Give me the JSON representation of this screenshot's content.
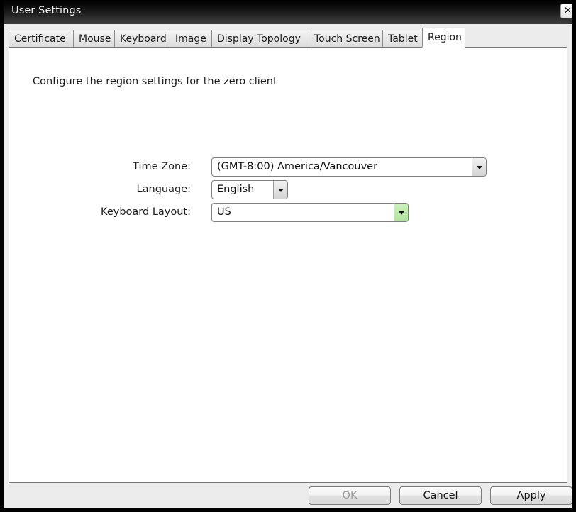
{
  "window": {
    "title": "User Settings",
    "close_icon": "close-icon",
    "close_glyph": "✕"
  },
  "tabs": [
    {
      "label": "Certificate",
      "selected": false
    },
    {
      "label": "Mouse",
      "selected": false
    },
    {
      "label": "Keyboard",
      "selected": false
    },
    {
      "label": "Image",
      "selected": false
    },
    {
      "label": "Display Topology",
      "selected": false
    },
    {
      "label": "Touch Screen",
      "selected": false
    },
    {
      "label": "Tablet",
      "selected": false
    },
    {
      "label": "Region",
      "selected": true
    }
  ],
  "panel": {
    "description": "Configure the region settings for the zero client",
    "fields": [
      {
        "label": "Time Zone:",
        "value": "(GMT-8:00) America/Vancouver",
        "arrow_icon": "chevron-down-icon",
        "highlighted": false
      },
      {
        "label": "Language:",
        "value": "English",
        "arrow_icon": "chevron-down-icon",
        "highlighted": false
      },
      {
        "label": "Keyboard Layout:",
        "value": "US",
        "arrow_icon": "chevron-down-icon",
        "highlighted": true
      }
    ]
  },
  "footer": {
    "ok_label": "OK",
    "cancel_label": "Cancel",
    "apply_label": "Apply"
  },
  "colors": {
    "titlebar_top": "#000000",
    "titlebar_bottom": "#3c3c3c",
    "window_border": "#000000",
    "panel_background": "#ffffff",
    "dialog_background": "#ececec",
    "tab_border": "#8d8d8d",
    "highlight_green": "#bfeaac",
    "disabled_text": "#9b9b9b"
  }
}
